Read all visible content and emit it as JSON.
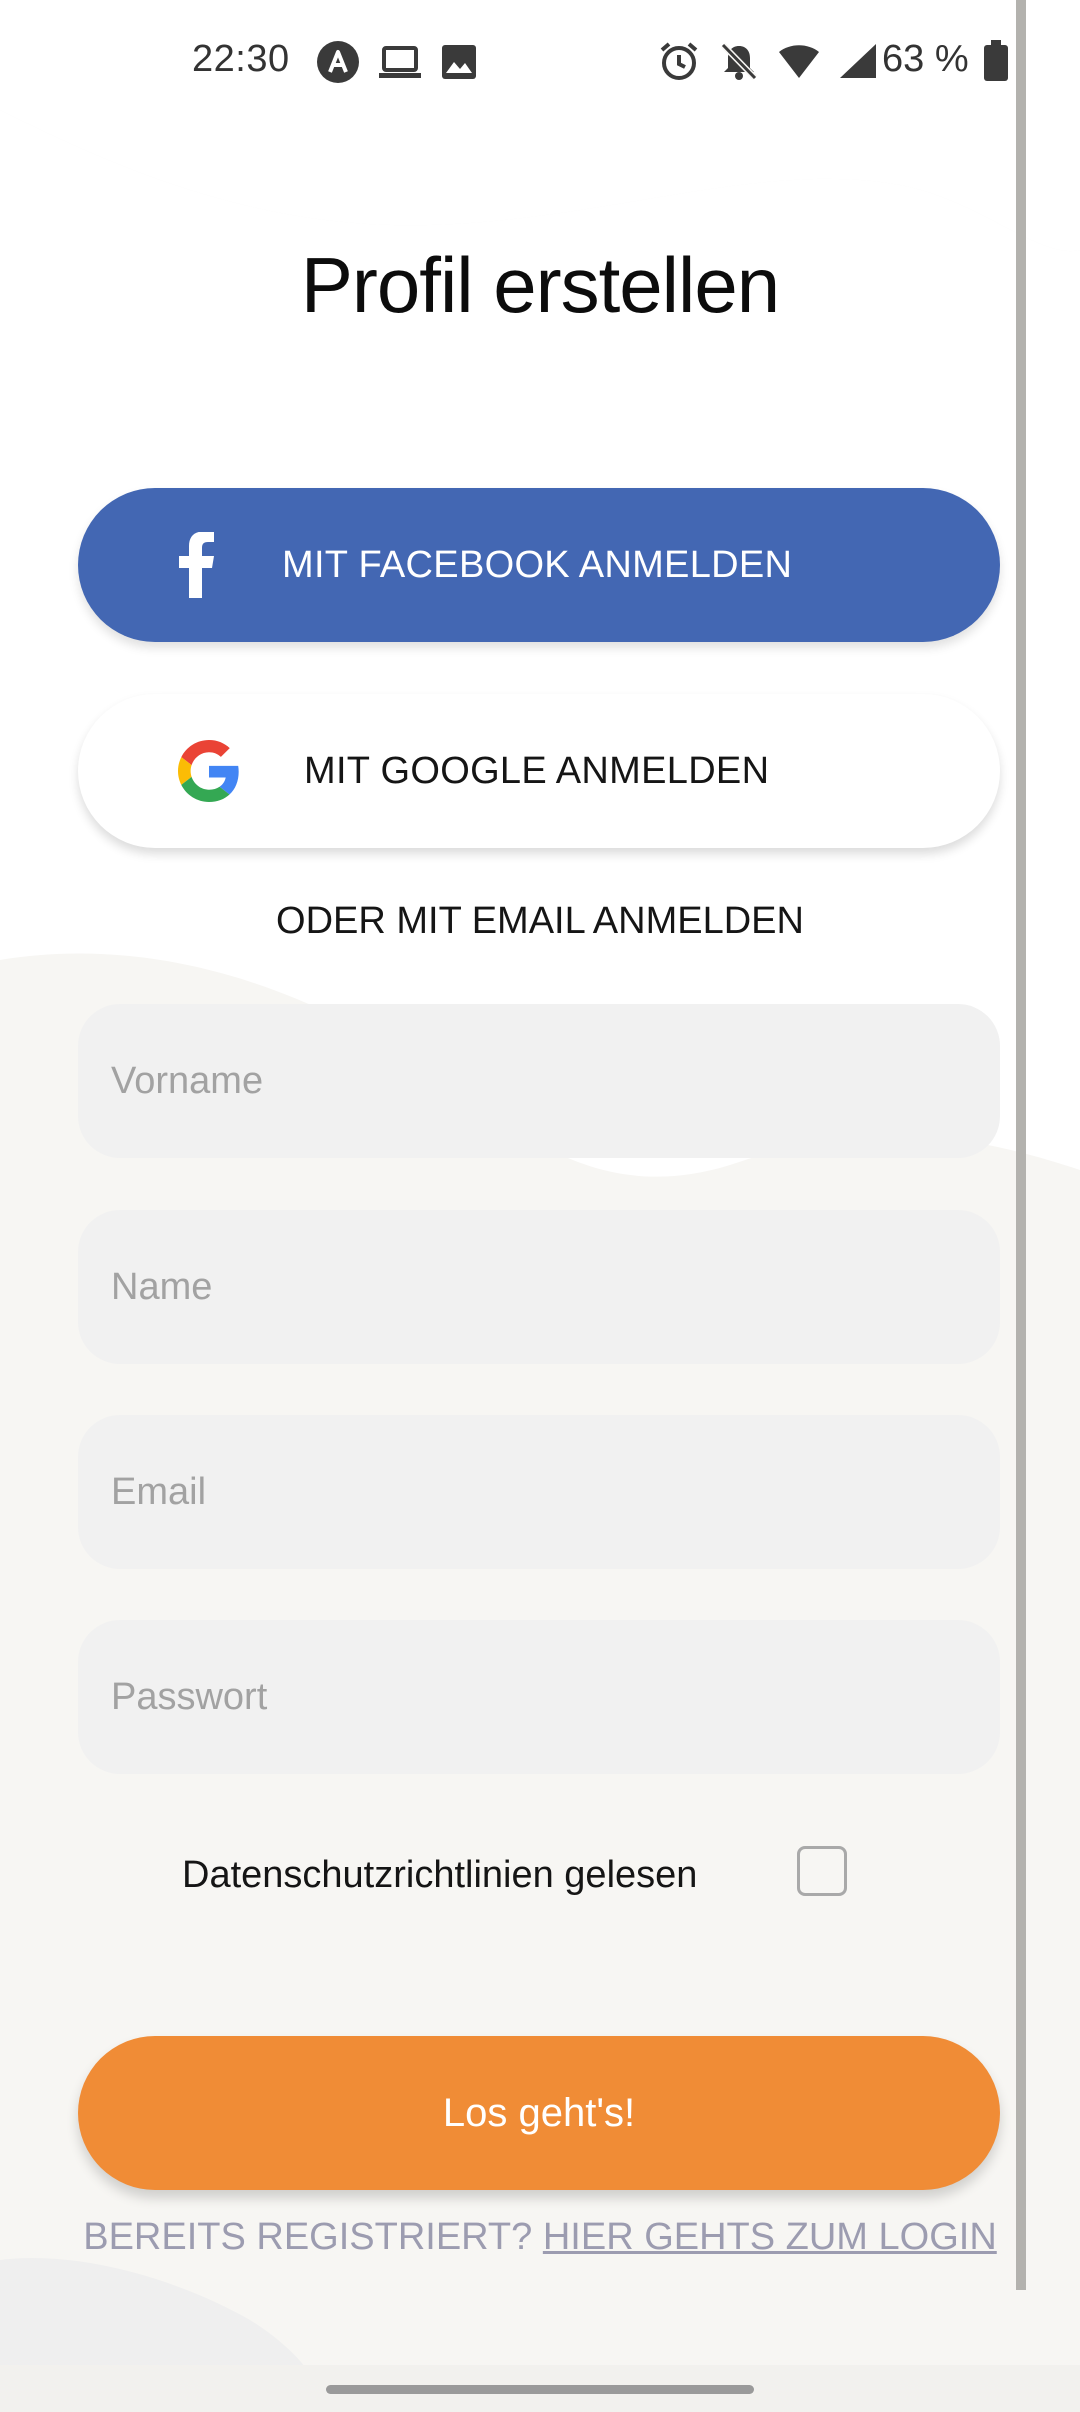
{
  "status_bar": {
    "time": "22:30",
    "battery_text": "63 %",
    "left_icons": [
      "app-notification-icon",
      "laptop-icon",
      "image-icon"
    ],
    "right_icons": [
      "alarm-icon",
      "bell-muted-icon",
      "wifi-icon",
      "signal-icon",
      "battery-icon"
    ]
  },
  "header": {
    "title": "Profil erstellen"
  },
  "social_login": {
    "facebook_label": "MIT FACEBOOK ANMELDEN",
    "google_label": "MIT GOOGLE ANMELDEN"
  },
  "divider_text": "ODER MIT EMAIL ANMELDEN",
  "form": {
    "first_name": {
      "placeholder": "Vorname",
      "value": ""
    },
    "last_name": {
      "placeholder": "Name",
      "value": ""
    },
    "email": {
      "placeholder": "Email",
      "value": ""
    },
    "password": {
      "placeholder": "Passwort",
      "value": ""
    },
    "privacy_label": "Datenschutzrichtlinien gelesen",
    "privacy_checked": false,
    "submit_label": "Los geht's!"
  },
  "footer": {
    "already_registered": "BEREITS REGISTRIERT?",
    "login_link": "HIER GEHTS ZUM LOGIN"
  },
  "colors": {
    "background": "#f7f6f3",
    "facebook": "#4367b3",
    "accent": "#f08c36",
    "input_bg": "#f1f1f1",
    "muted_text": "#9c9cb0"
  }
}
